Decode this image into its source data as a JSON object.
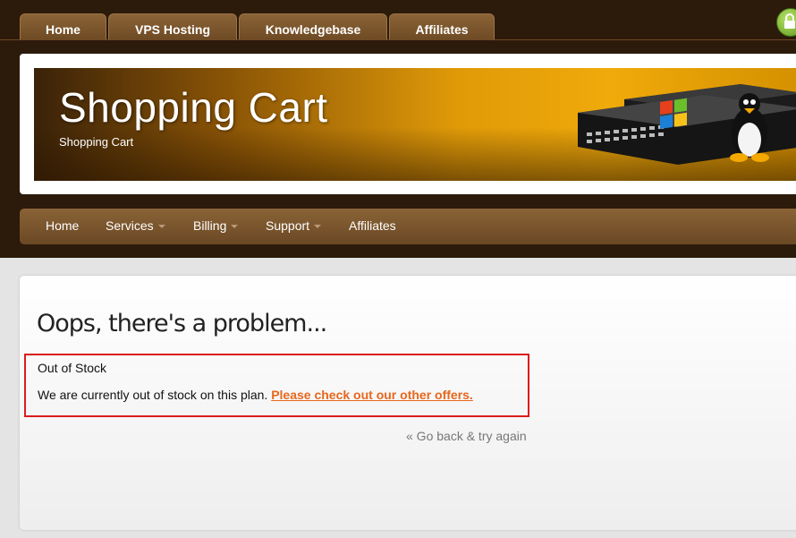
{
  "top_tabs": [
    "Home",
    "VPS Hosting",
    "Knowledgebase",
    "Affiliates"
  ],
  "banner": {
    "title": "Shopping Cart",
    "subtitle": "Shopping Cart"
  },
  "nav": {
    "items": [
      {
        "label": "Home",
        "dropdown": false
      },
      {
        "label": "Services",
        "dropdown": true
      },
      {
        "label": "Billing",
        "dropdown": true
      },
      {
        "label": "Support",
        "dropdown": true
      },
      {
        "label": "Affiliates",
        "dropdown": false
      }
    ]
  },
  "main": {
    "heading": "Oops, there's a problem...",
    "alert_title": "Out of Stock",
    "alert_message": "We are currently out of stock on this plan.",
    "alert_link": "Please check out our other offers.",
    "back_link": "« Go back & try again"
  },
  "colors": {
    "header_bg": "#2c1a0b",
    "tab_bg": "#7a5630",
    "alert_border": "#dd1c1c",
    "link_orange": "#e8671c"
  },
  "icons": {
    "cart_button": "lock-icon"
  }
}
